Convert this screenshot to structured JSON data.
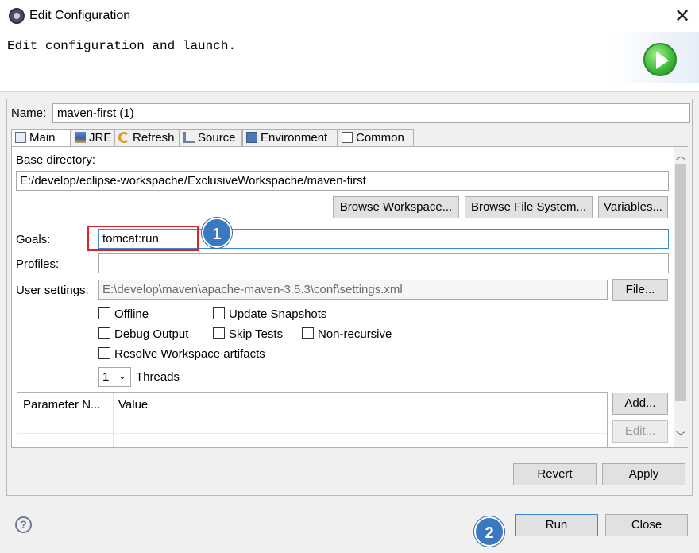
{
  "window": {
    "title": "Edit Configuration",
    "app_icon": "eclipse-gear-icon",
    "close_glyph": "✕"
  },
  "banner": {
    "message": "Edit configuration and launch.",
    "image": "run-launch-icon"
  },
  "name": {
    "label": "Name:",
    "value": "maven-first (1)"
  },
  "tabs": [
    {
      "label": "Main",
      "icon": "main-tab-icon",
      "active": true
    },
    {
      "label": "JRE",
      "icon": "jre-icon",
      "active": false
    },
    {
      "label": "Refresh",
      "icon": "refresh-icon",
      "active": false
    },
    {
      "label": "Source",
      "icon": "source-icon",
      "active": false
    },
    {
      "label": "Environment",
      "icon": "environment-icon",
      "active": false
    },
    {
      "label": "Common",
      "icon": "common-icon",
      "active": false
    }
  ],
  "main": {
    "base_directory_label": "Base directory:",
    "base_directory_value": "E:/develop/eclipse-workspache/ExclusiveWorkspache/maven-first",
    "browse_workspace": "Browse Workspace...",
    "browse_file_system": "Browse File System...",
    "variables": "Variables...",
    "goals_label": "Goals:",
    "goals_value": "tomcat:run",
    "profiles_label": "Profiles:",
    "profiles_value": "",
    "user_settings_label": "User settings:",
    "user_settings_value": "E:\\develop\\maven\\apache-maven-3.5.3\\conf\\settings.xml",
    "file_button": "File...",
    "checkboxes": {
      "offline": "Offline",
      "update_snapshots": "Update Snapshots",
      "debug_output": "Debug Output",
      "skip_tests": "Skip Tests",
      "non_recursive": "Non-recursive",
      "resolve_workspace": "Resolve Workspace artifacts"
    },
    "threads_value": "1",
    "threads_label": "Threads",
    "param_columns": [
      "Parameter N...",
      "Value"
    ],
    "add_button": "Add...",
    "edit_button": "Edit..."
  },
  "footer": {
    "revert": "Revert",
    "apply": "Apply",
    "run": "Run",
    "close": "Close",
    "help_glyph": "?"
  },
  "annotations": [
    "1",
    "2"
  ],
  "colors": {
    "annotation_box": "#e02424",
    "annotation_badge": "#3b78c2",
    "focus_border": "#3a89d6"
  }
}
